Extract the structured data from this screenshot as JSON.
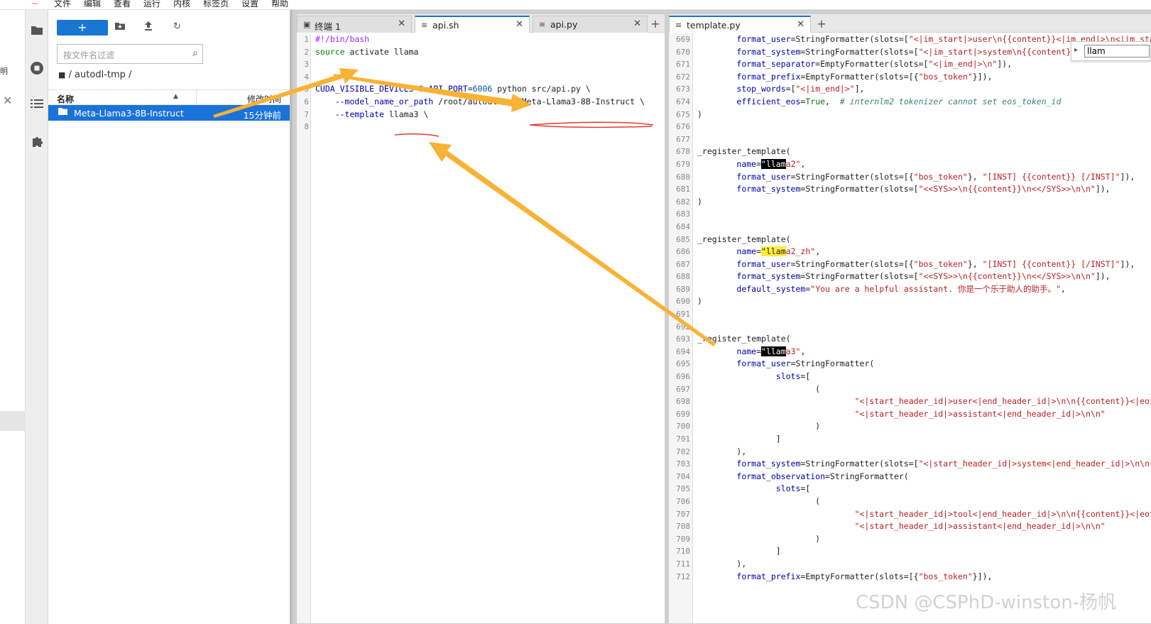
{
  "menubar": {
    "logo": "~",
    "items": [
      "文件",
      "编辑",
      "查看",
      "运行",
      "内核",
      "标签页",
      "设置",
      "帮助"
    ]
  },
  "cutstrip": {
    "text": "明"
  },
  "activitybar": {
    "icons": [
      "folder-icon",
      "stop-icon",
      "list-icon",
      "extension-icon"
    ]
  },
  "filebrowser": {
    "new_label": "+",
    "filter_placeholder": "按文件名过滤",
    "breadcrumb": "/ autodl-tmp /",
    "col_name": "名称",
    "col_modified": "修改时间",
    "files": [
      {
        "name": "Meta-Llama3-8B-Instruct",
        "modified": "15分钟前",
        "selected": true
      }
    ]
  },
  "panel1": {
    "tabs": [
      {
        "label": "终端 1",
        "icon": "terminal-icon",
        "active": false
      },
      {
        "label": "api.sh",
        "icon": "file-icon",
        "active": true
      },
      {
        "label": "api.py",
        "icon": "file-icon",
        "active": false
      }
    ],
    "add_label": "+",
    "line_numbers": [
      "1",
      "2",
      "3",
      "4",
      "5",
      "6",
      "7",
      "8"
    ]
  },
  "panel2": {
    "tabs": [
      {
        "label": "template.py",
        "icon": "file-icon",
        "active": true
      }
    ],
    "add_label": "+",
    "search_value": "llam",
    "line_start": 669,
    "line_end": 712
  },
  "watermark": "CSDN @CSPhD-winston-杨帆",
  "colors": {
    "accent": "#1976d2",
    "selection": "#1a73d9",
    "arrow": "#f9b233",
    "underline": "#e53935"
  }
}
